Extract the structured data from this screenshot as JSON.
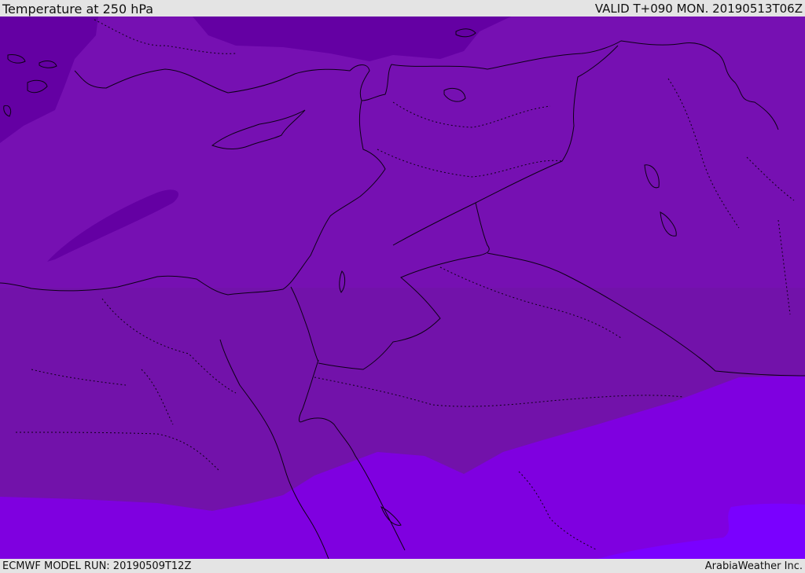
{
  "header": {
    "title": "Temperature at 250 hPa",
    "valid": "VALID T+090 MON. 20190513T06Z"
  },
  "footer": {
    "model_run": "ECMWF MODEL RUN: 20190509T12Z",
    "credit": "ArabiaWeather Inc."
  },
  "map": {
    "field": "temperature-250hpa",
    "colors": {
      "cold_dark": "#6400a3",
      "base": "#7610b2",
      "mid_dark": "#7212aa",
      "warm": "#7f00e0",
      "warmest": "#7a00ff",
      "border": "#0d0016"
    }
  }
}
